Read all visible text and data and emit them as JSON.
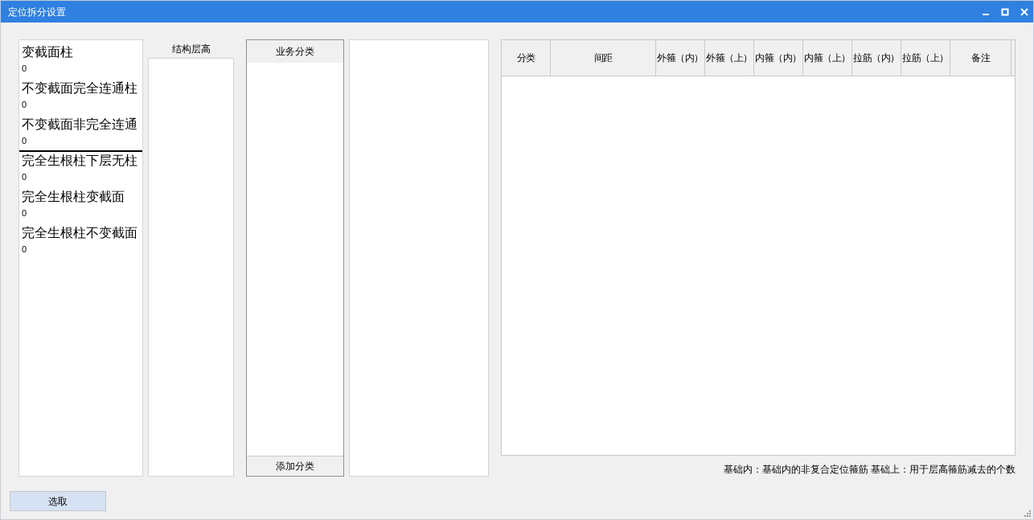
{
  "window": {
    "title": "定位拆分设置"
  },
  "column_list": {
    "items": [
      {
        "name": "变截面柱",
        "count": "0",
        "divider": false
      },
      {
        "name": "不变截面完全连通柱",
        "count": "0",
        "divider": false
      },
      {
        "name": "不变截面非完全连通",
        "count": "0",
        "divider": true
      },
      {
        "name": "完全生根柱下层无柱",
        "count": "0",
        "divider": false
      },
      {
        "name": "完全生根柱变截面",
        "count": "0",
        "divider": false
      },
      {
        "name": "完全生根柱不变截面",
        "count": "0",
        "divider": false
      }
    ]
  },
  "floor_height": {
    "label": "结构层高"
  },
  "business_category": {
    "header": "业务分类",
    "add_button": "添加分类"
  },
  "table": {
    "columns": [
      "分类",
      "间距",
      "外箍（内）",
      "外箍（上）",
      "内箍（内）",
      "内箍（上）",
      "拉筋（内）",
      "拉筋（上）",
      "备注"
    ]
  },
  "note": "基础内：基础内的非复合定位箍筋 基础上：用于层高箍筋减去的个数",
  "select_button": "选取"
}
